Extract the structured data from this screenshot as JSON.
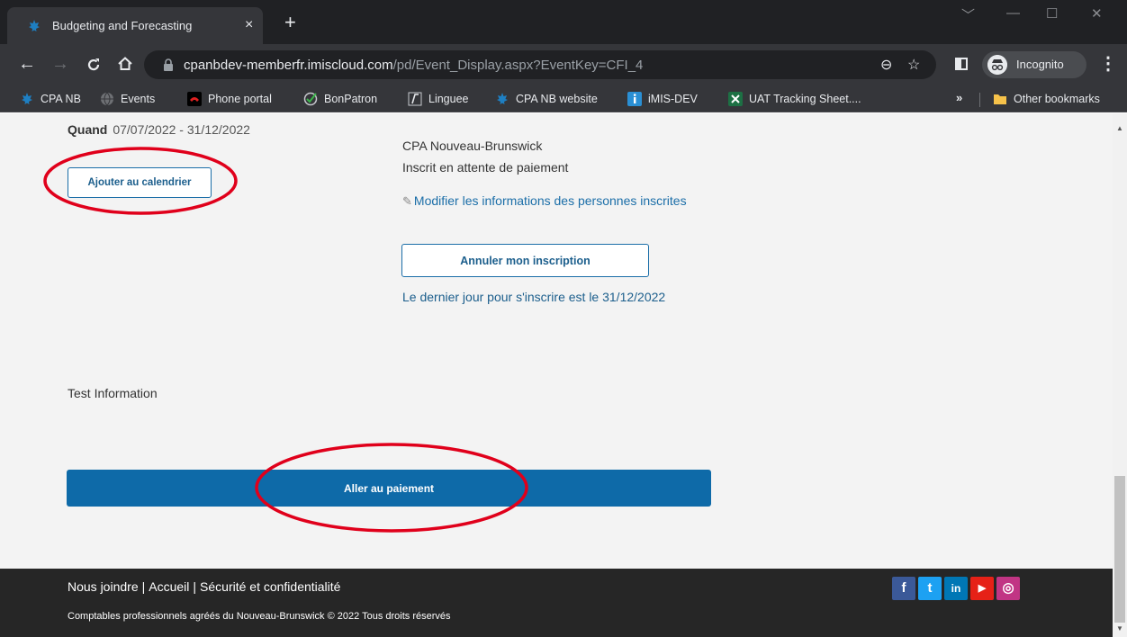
{
  "browser": {
    "tab_title": "Budgeting and Forecasting",
    "tab_close": "×",
    "new_tab": "+",
    "url_host": "cpanbdev-memberfr.imiscloud.com",
    "url_path": "/pd/Event_Display.aspx?EventKey=CFI_4",
    "incognito_label": "Incognito",
    "window_controls": [
      "﹀",
      "—",
      "☐",
      "✕"
    ]
  },
  "bookmarks": [
    {
      "label": "CPA NB",
      "icon": "maple-leaf-icon"
    },
    {
      "label": "Events",
      "icon": "globe-icon"
    },
    {
      "label": "Phone portal",
      "icon": "phone-icon"
    },
    {
      "label": "BonPatron",
      "icon": "check-icon"
    },
    {
      "label": "Linguee",
      "icon": "linguee-icon"
    },
    {
      "label": "CPA NB website",
      "icon": "maple-leaf-icon"
    },
    {
      "label": "iMIS-DEV",
      "icon": "info-icon"
    },
    {
      "label": "UAT Tracking Sheet....",
      "icon": "excel-icon"
    }
  ],
  "bookmarks_overflow": "»",
  "other_bookmarks": "Other bookmarks",
  "event": {
    "when_label": "Quand",
    "when_value": "07/07/2022 - 31/12/2022",
    "add_calendar": "Ajouter au calendrier",
    "organization": "CPA Nouveau-Brunswick",
    "status": "Inscrit en attente de paiement",
    "edit_link": "Modifier les informations des personnes inscrites",
    "cancel_button": "Annuler mon inscription",
    "deadline": "Le dernier jour pour s'inscrire est le 31/12/2022",
    "test_info": "Test Information",
    "pay_button": "Aller au paiement"
  },
  "footer": {
    "links": [
      "Nous joindre",
      "Accueil",
      "Sécurité et confidentialité"
    ],
    "copyright": "Comptables professionnels agréés du Nouveau-Brunswick © 2022 Tous droits réservés",
    "social": [
      {
        "name": "facebook",
        "glyph": "f",
        "color": "#3b5998"
      },
      {
        "name": "twitter",
        "glyph": "t",
        "color": "#1da1f2"
      },
      {
        "name": "linkedin",
        "glyph": "in",
        "color": "#0077b5"
      },
      {
        "name": "youtube",
        "glyph": "▶",
        "color": "#e62117"
      },
      {
        "name": "instagram",
        "glyph": "◎",
        "color": "#c13584"
      }
    ]
  },
  "colors": {
    "accent": "#0e6aa8",
    "link": "#1b6ea8",
    "annotation": "#e0001b",
    "footer_bg": "#262626"
  }
}
